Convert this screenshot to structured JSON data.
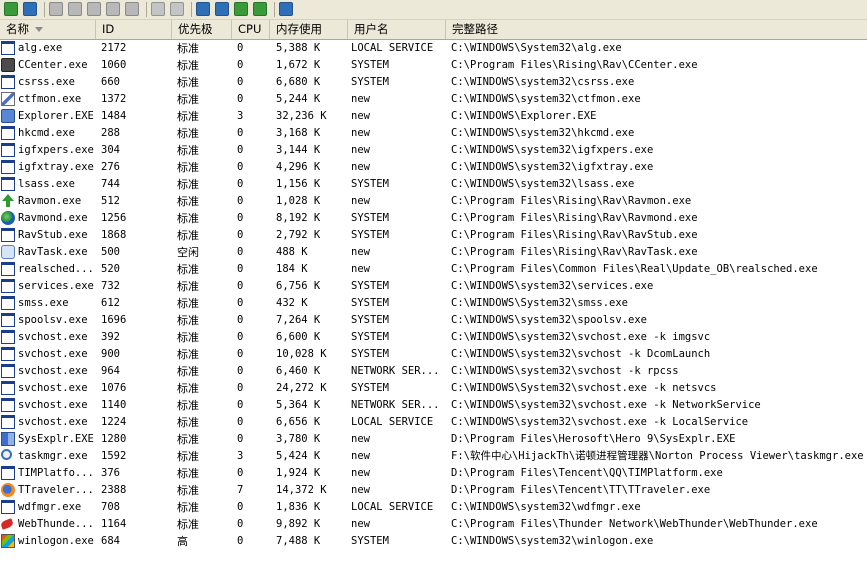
{
  "columns": {
    "name": "名称",
    "id": "ID",
    "priority": "优先极",
    "cpu": "CPU",
    "memory": "内存使用",
    "user": "用户名",
    "path": "完整路径"
  },
  "processes": [
    {
      "icon": "window",
      "name": "alg.exe",
      "id": "2172",
      "priority": "标准",
      "cpu": "0",
      "memory": "5,388 K",
      "user": "LOCAL SERVICE",
      "path": "C:\\WINDOWS\\System32\\alg.exe"
    },
    {
      "icon": "gear",
      "name": "CCenter.exe",
      "id": "1060",
      "priority": "标准",
      "cpu": "0",
      "memory": "1,672 K",
      "user": "SYSTEM",
      "path": "C:\\Program Files\\Rising\\Rav\\CCenter.exe"
    },
    {
      "icon": "window",
      "name": "csrss.exe",
      "id": "660",
      "priority": "标准",
      "cpu": "0",
      "memory": "6,680 K",
      "user": "SYSTEM",
      "path": "C:\\WINDOWS\\system32\\csrss.exe"
    },
    {
      "icon": "pencil",
      "name": "ctfmon.exe",
      "id": "1372",
      "priority": "标准",
      "cpu": "0",
      "memory": "5,244 K",
      "user": "new",
      "path": "C:\\WINDOWS\\system32\\ctfmon.exe"
    },
    {
      "icon": "monitor",
      "name": "Explorer.EXE",
      "id": "1484",
      "priority": "标准",
      "cpu": "3",
      "memory": "32,236 K",
      "user": "new",
      "path": "C:\\WINDOWS\\Explorer.EXE"
    },
    {
      "icon": "window",
      "name": "hkcmd.exe",
      "id": "288",
      "priority": "标准",
      "cpu": "0",
      "memory": "3,168 K",
      "user": "new",
      "path": "C:\\WINDOWS\\system32\\hkcmd.exe"
    },
    {
      "icon": "window",
      "name": "igfxpers.exe",
      "id": "304",
      "priority": "标准",
      "cpu": "0",
      "memory": "3,144 K",
      "user": "new",
      "path": "C:\\WINDOWS\\system32\\igfxpers.exe"
    },
    {
      "icon": "window",
      "name": "igfxtray.exe",
      "id": "276",
      "priority": "标准",
      "cpu": "0",
      "memory": "4,296 K",
      "user": "new",
      "path": "C:\\WINDOWS\\system32\\igfxtray.exe"
    },
    {
      "icon": "window",
      "name": "lsass.exe",
      "id": "744",
      "priority": "标准",
      "cpu": "0",
      "memory": "1,156 K",
      "user": "SYSTEM",
      "path": "C:\\WINDOWS\\system32\\lsass.exe"
    },
    {
      "icon": "arrow-green",
      "name": "Ravmon.exe",
      "id": "512",
      "priority": "标准",
      "cpu": "0",
      "memory": "1,028 K",
      "user": "new",
      "path": "C:\\Program Files\\Rising\\Rav\\Ravmon.exe"
    },
    {
      "icon": "globe",
      "name": "Ravmond.exe",
      "id": "1256",
      "priority": "标准",
      "cpu": "0",
      "memory": "8,192 K",
      "user": "SYSTEM",
      "path": "C:\\Program Files\\Rising\\Rav\\Ravmond.exe"
    },
    {
      "icon": "window",
      "name": "RavStub.exe",
      "id": "1868",
      "priority": "标准",
      "cpu": "0",
      "memory": "2,792 K",
      "user": "SYSTEM",
      "path": "C:\\Program Files\\Rising\\Rav\\RavStub.exe"
    },
    {
      "icon": "scan",
      "name": "RavTask.exe",
      "id": "500",
      "priority": "空闲",
      "cpu": "0",
      "memory": "488 K",
      "user": "new",
      "path": "C:\\Program Files\\Rising\\Rav\\RavTask.exe"
    },
    {
      "icon": "window",
      "name": "realsched...",
      "id": "520",
      "priority": "标准",
      "cpu": "0",
      "memory": "184 K",
      "user": "new",
      "path": "C:\\Program Files\\Common Files\\Real\\Update_OB\\realsched.exe"
    },
    {
      "icon": "window",
      "name": "services.exe",
      "id": "732",
      "priority": "标准",
      "cpu": "0",
      "memory": "6,756 K",
      "user": "SYSTEM",
      "path": "C:\\WINDOWS\\system32\\services.exe"
    },
    {
      "icon": "window",
      "name": "smss.exe",
      "id": "612",
      "priority": "标准",
      "cpu": "0",
      "memory": "432 K",
      "user": "SYSTEM",
      "path": "C:\\WINDOWS\\System32\\smss.exe"
    },
    {
      "icon": "window",
      "name": "spoolsv.exe",
      "id": "1696",
      "priority": "标准",
      "cpu": "0",
      "memory": "7,264 K",
      "user": "SYSTEM",
      "path": "C:\\WINDOWS\\system32\\spoolsv.exe"
    },
    {
      "icon": "window",
      "name": "svchost.exe",
      "id": "392",
      "priority": "标准",
      "cpu": "0",
      "memory": "6,600 K",
      "user": "SYSTEM",
      "path": "C:\\WINDOWS\\system32\\svchost.exe -k imgsvc"
    },
    {
      "icon": "window",
      "name": "svchost.exe",
      "id": "900",
      "priority": "标准",
      "cpu": "0",
      "memory": "10,028 K",
      "user": "SYSTEM",
      "path": "C:\\WINDOWS\\system32\\svchost -k DcomLaunch"
    },
    {
      "icon": "window",
      "name": "svchost.exe",
      "id": "964",
      "priority": "标准",
      "cpu": "0",
      "memory": "6,460 K",
      "user": "NETWORK SER...",
      "path": "C:\\WINDOWS\\system32\\svchost -k rpcss"
    },
    {
      "icon": "window",
      "name": "svchost.exe",
      "id": "1076",
      "priority": "标准",
      "cpu": "0",
      "memory": "24,272 K",
      "user": "SYSTEM",
      "path": "C:\\WINDOWS\\System32\\svchost.exe -k netsvcs"
    },
    {
      "icon": "window",
      "name": "svchost.exe",
      "id": "1140",
      "priority": "标准",
      "cpu": "0",
      "memory": "5,364 K",
      "user": "NETWORK SER...",
      "path": "C:\\WINDOWS\\system32\\svchost.exe -k NetworkService"
    },
    {
      "icon": "window",
      "name": "svchost.exe",
      "id": "1224",
      "priority": "标准",
      "cpu": "0",
      "memory": "6,656 K",
      "user": "LOCAL SERVICE",
      "path": "C:\\WINDOWS\\system32\\svchost.exe -k LocalService"
    },
    {
      "icon": "sysexp",
      "name": "SysExplr.EXE",
      "id": "1280",
      "priority": "标准",
      "cpu": "0",
      "memory": "3,780 K",
      "user": "new",
      "path": "D:\\Program Files\\Herosoft\\Hero 9\\SysExplr.EXE"
    },
    {
      "icon": "magnifier",
      "name": "taskmgr.exe",
      "id": "1592",
      "priority": "标准",
      "cpu": "3",
      "memory": "5,424 K",
      "user": "new",
      "path": "F:\\软件中心\\HijackTh\\诺顿进程管理器\\Norton Process Viewer\\taskmgr.exe"
    },
    {
      "icon": "window",
      "name": "TIMPlatfo...",
      "id": "376",
      "priority": "标准",
      "cpu": "0",
      "memory": "1,924 K",
      "user": "new",
      "path": "D:\\Program Files\\Tencent\\QQ\\TIMPlatform.exe"
    },
    {
      "icon": "firefox",
      "name": "TTraveler...",
      "id": "2388",
      "priority": "标准",
      "cpu": "7",
      "memory": "14,372 K",
      "user": "new",
      "path": "D:\\Program Files\\Tencent\\TT\\TTraveler.exe"
    },
    {
      "icon": "window",
      "name": "wdfmgr.exe",
      "id": "708",
      "priority": "标准",
      "cpu": "0",
      "memory": "1,836 K",
      "user": "LOCAL SERVICE",
      "path": "C:\\WINDOWS\\system32\\wdfmgr.exe"
    },
    {
      "icon": "thunder",
      "name": "WebThunde...",
      "id": "1164",
      "priority": "标准",
      "cpu": "0",
      "memory": "9,892 K",
      "user": "new",
      "path": "C:\\Program Files\\Thunder Network\\WebThunder\\WebThunder.exe"
    },
    {
      "icon": "winlogon",
      "name": "winlogon.exe",
      "id": "684",
      "priority": "高",
      "cpu": "0",
      "memory": "7,488 K",
      "user": "SYSTEM",
      "path": "C:\\WINDOWS\\system32\\winlogon.exe"
    }
  ],
  "toolbar": {
    "buttons": [
      {
        "name": "refresh-icon",
        "color": "#3a9a3a"
      },
      {
        "name": "save-icon",
        "color": "#2f6fb8"
      },
      {
        "name": "copy-icon",
        "color": "#b8b8b8"
      },
      {
        "name": "tree-icon",
        "color": "#b8b8b8"
      },
      {
        "name": "properties-icon",
        "color": "#b8b8b8"
      },
      {
        "name": "record-icon",
        "color": "#b8b8b8"
      },
      {
        "name": "page-icon",
        "color": "#b8b8b8"
      },
      {
        "name": "delete-icon",
        "color": "#c4c4c4"
      },
      {
        "name": "info-icon",
        "color": "#c4c4c4"
      },
      {
        "name": "process-list-icon",
        "color": "#2f6fb8"
      },
      {
        "name": "module-list-icon",
        "color": "#2f6fb8"
      },
      {
        "name": "window-copy-icon",
        "color": "#3a9a3a"
      },
      {
        "name": "window-check-icon",
        "color": "#3a9a3a"
      },
      {
        "name": "search-icon",
        "color": "#2f6fb8"
      }
    ]
  }
}
